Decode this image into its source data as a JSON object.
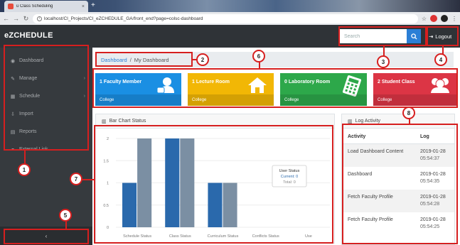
{
  "browser": {
    "tab_title": "ü Class Scheduling",
    "tab_close": "×",
    "new_tab": "+",
    "url": "localhost/CI_Projects/CI_eZCHEDULE_GA/front_end?page=colsc-dashboard"
  },
  "header": {
    "brand": "eZCHEDULE",
    "search_placeholder": "Search",
    "logout_label": "Logout"
  },
  "sidebar": {
    "items": [
      {
        "label": "Dashboard",
        "icon": "dashboard-icon",
        "caret": ""
      },
      {
        "label": "Manage",
        "icon": "wrench-icon",
        "caret": "›"
      },
      {
        "label": "Schedule",
        "icon": "calendar-icon",
        "caret": "›"
      },
      {
        "label": "Import",
        "icon": "import-icon",
        "caret": ""
      },
      {
        "label": "Reports",
        "icon": "print-icon",
        "caret": ""
      },
      {
        "label": "External Link",
        "icon": "link-icon",
        "caret": ""
      }
    ],
    "collapse_label": "‹"
  },
  "breadcrumb": {
    "home": "Dashboard",
    "separator": "/",
    "current": "My Dashboard"
  },
  "cards": [
    {
      "count": "1",
      "label": "Faculty Member",
      "foot": "College",
      "color": "#1a8fe3",
      "icon": "faculty-icon"
    },
    {
      "count": "1",
      "label": "Lecture Room",
      "foot": "College",
      "color": "#f2b705",
      "icon": "house-icon"
    },
    {
      "count": "0",
      "label": "Laboratory Room",
      "foot": "College",
      "color": "#2da84a",
      "icon": "calculator-icon"
    },
    {
      "count": "2",
      "label": "Student Class",
      "foot": "College",
      "color": "#dc3545",
      "icon": "students-icon"
    }
  ],
  "chart_panel": {
    "title": "Bar Chart Status"
  },
  "chart_data": {
    "type": "bar",
    "categories": [
      "Schedule Status",
      "Class Status",
      "Curriculum Status",
      "Conflicts Status",
      "Use"
    ],
    "series": [
      {
        "name": "",
        "color": "#2a69ac",
        "values": [
          1,
          2,
          1,
          0,
          0
        ]
      },
      {
        "name": "",
        "color": "#7b8fa3",
        "values": [
          2,
          2,
          1,
          0,
          0
        ]
      }
    ],
    "yticks": [
      "0",
      "0.5",
      "1",
      "1.5",
      "2"
    ],
    "ylim": [
      0,
      2
    ],
    "tooltip": {
      "title": "User Status",
      "line1": "Current: 0",
      "line2": "Total: 0"
    }
  },
  "log_panel": {
    "title": "Log Activity",
    "col_activity": "Activity",
    "col_log": "Log",
    "rows": [
      {
        "activity": "Load Dashboard Content",
        "date": "2019-01-28",
        "time": "05:54:37"
      },
      {
        "activity": "Dashboard",
        "date": "2019-01-28",
        "time": "05:54:35"
      },
      {
        "activity": "Fetch Faculty Profile",
        "date": "2019-01-28",
        "time": "05:54:28"
      },
      {
        "activity": "Fetch Faculty Profile",
        "date": "2019-01-28",
        "time": "05:54:25"
      }
    ]
  },
  "annotations": [
    "1",
    "2",
    "3",
    "4",
    "5",
    "6",
    "7",
    "8"
  ]
}
